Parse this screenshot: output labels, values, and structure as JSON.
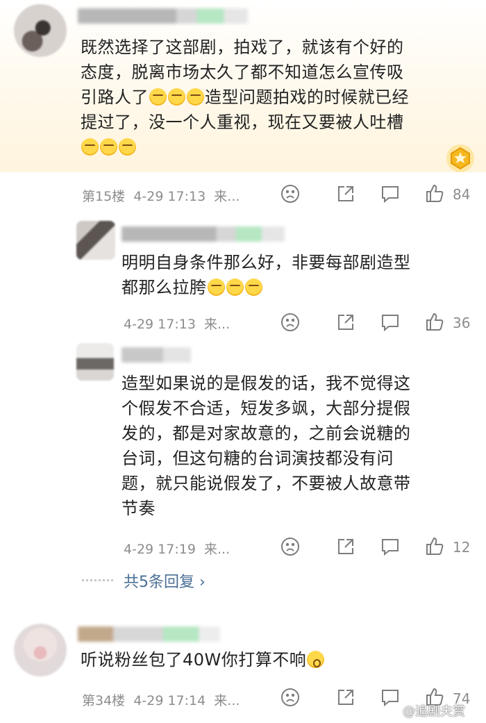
{
  "comments": [
    {
      "text_lines": [
        "既然选择了这部剧，拍戏了，就该有个好的",
        "态度，脱离市场太久了都不知道怎么宣传吸",
        "引路人了",
        "造型问题拍戏的时候就已经",
        "提过了，没一个人重视，现在又要被人吐槽"
      ],
      "floor": "第15楼",
      "time": "4-29 17:13",
      "source": "来...",
      "likes": "84"
    },
    {
      "text_lines": [
        "明明自身条件那么好，非要每部剧造型",
        "都那么拉胯"
      ],
      "time": "4-29 17:13",
      "source": "来...",
      "likes": "36"
    },
    {
      "text_lines": [
        "造型如果说的是假发的话，我不觉得这",
        "个假发不合适，短发多飒，大部分提假",
        "发的，都是对家故意的，之前会说糖的",
        "台词，但这句糖的台词演技都没有问",
        "题，就只能说假发了，不要被人故意带",
        "节奏"
      ],
      "time": "4-29 17:19",
      "source": "来...",
      "likes": "12"
    },
    {
      "text_lines": [
        "听说粉丝包了40W你打算不响"
      ],
      "floor": "第34楼",
      "time": "4-29 17:14",
      "source": "来...",
      "likes": "74"
    }
  ],
  "replies_link": "共5条回复",
  "replies_chevron": "›",
  "watermark": "@追剧夫赏",
  "icons": {
    "dislike": "frown-face-icon",
    "share": "share-icon",
    "reply": "comment-bubble-icon",
    "like": "thumbs-up-icon",
    "badge": "gold-crown-badge-icon",
    "emoji": "thinking-emoji-icon"
  }
}
